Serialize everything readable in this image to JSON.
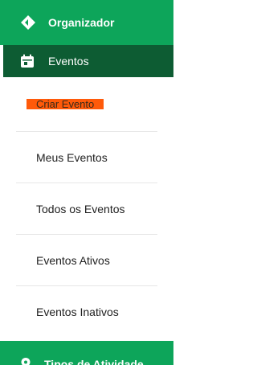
{
  "colors": {
    "header_green": "#0da55a",
    "active_green": "#0d5c33",
    "highlight_orange": "#ff5a0a",
    "text_dark": "#212121",
    "divider": "#e6e6e6"
  },
  "header": {
    "label": "Organizador",
    "icon": "diamond-direction-icon"
  },
  "active_section": {
    "label": "Eventos",
    "icon": "calendar-icon"
  },
  "submenu": {
    "items": [
      {
        "label": "Criar Evento",
        "highlighted": true
      },
      {
        "label": "Meus Eventos"
      },
      {
        "label": "Todos os Eventos"
      },
      {
        "label": "Eventos Ativos"
      },
      {
        "label": "Eventos Inativos"
      }
    ]
  },
  "bottom_section": {
    "label": "Tipos de Atividade",
    "icon": "location-pin-icon"
  }
}
